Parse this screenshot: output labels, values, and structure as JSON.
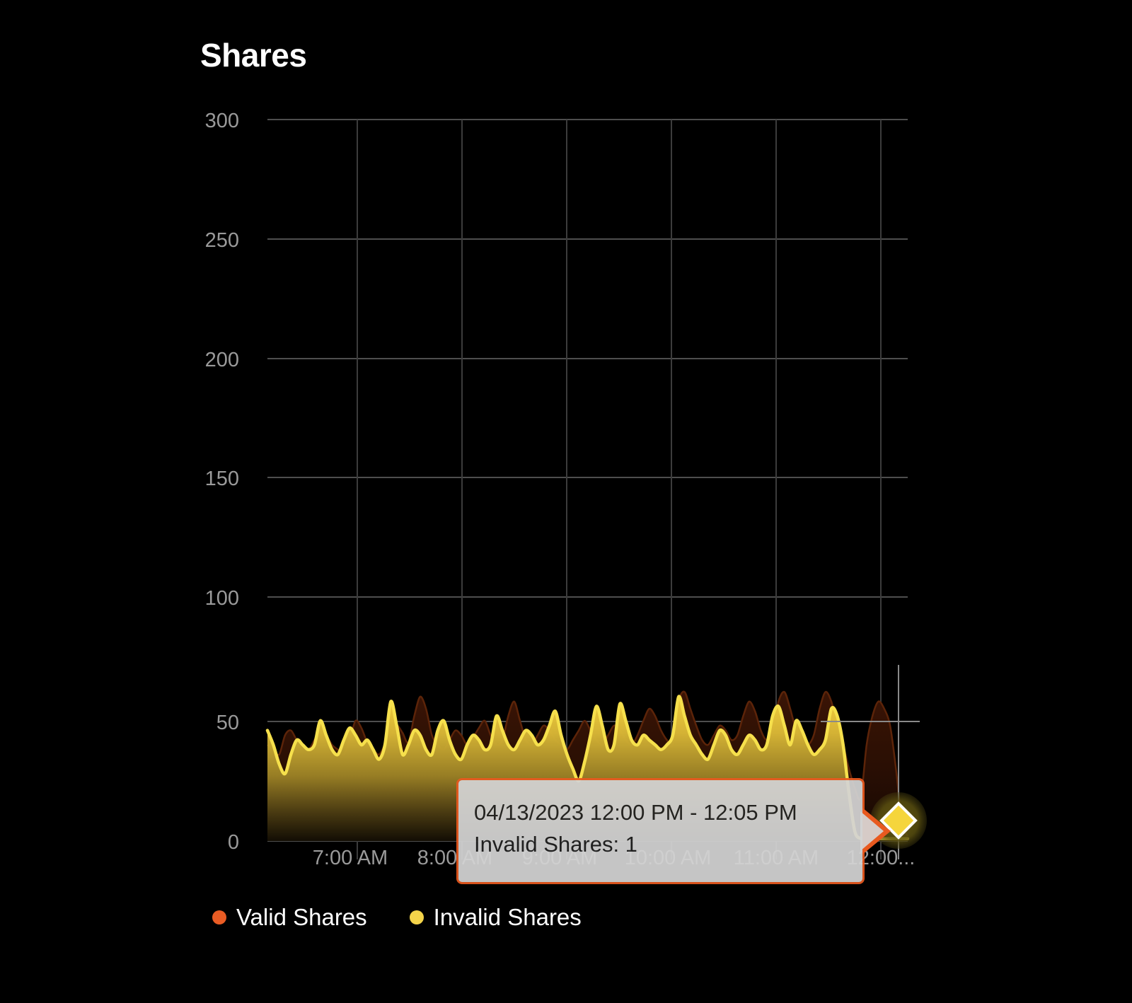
{
  "chart_title": "Shares",
  "legend": {
    "items": [
      {
        "label": "Valid Shares",
        "color": "#ea5c24"
      },
      {
        "label": "Invalid Shares",
        "color": "#f4d44a"
      }
    ]
  },
  "tooltip": {
    "time_range": "04/13/2023 12:00 PM - 12:05 PM",
    "value_line": "Invalid Shares: 1"
  },
  "axis": {
    "y_ticks": [
      "0",
      "50",
      "100",
      "150",
      "200",
      "250",
      "300"
    ],
    "x_ticks": [
      "7:00 AM",
      "8:00 AM",
      "9:00 AM",
      "10:00 AM",
      "11:00 AM",
      "12:00..."
    ]
  },
  "chart_data": {
    "type": "area",
    "title": "Shares",
    "xlabel": "",
    "ylabel": "",
    "ylim": [
      0,
      300
    ],
    "y_ticks": [
      0,
      50,
      100,
      150,
      200,
      250,
      300
    ],
    "x_tick_labels": [
      "7:00 AM",
      "8:00 AM",
      "9:00 AM",
      "10:00 AM",
      "11:00 AM",
      "12:00..."
    ],
    "x_range": "04/13/2023 06:40 AM - 12:20 PM",
    "grid": true,
    "legend_position": "bottom-left",
    "interval_minutes": 5,
    "highlighted_point": {
      "series": "Invalid Shares",
      "label": "04/13/2023 12:00 PM - 12:05 PM",
      "value": 1
    },
    "series": [
      {
        "name": "Valid Shares",
        "color": "#ea5c24",
        "fill_opacity": 0.28,
        "values": [
          40,
          38,
          36,
          44,
          46,
          42,
          40,
          38,
          42,
          46,
          44,
          40,
          38,
          36,
          42,
          50,
          47,
          41,
          38,
          36,
          40,
          44,
          48,
          45,
          41,
          52,
          60,
          55,
          44,
          40,
          38,
          42,
          46,
          44,
          40,
          43,
          47,
          50,
          44,
          40,
          42,
          52,
          58,
          50,
          42,
          40,
          44,
          48,
          46,
          42,
          40,
          38,
          42,
          46,
          50,
          46,
          42,
          40,
          44,
          48,
          46,
          42,
          40,
          44,
          50,
          55,
          52,
          46,
          42,
          40,
          58,
          62,
          55,
          48,
          42,
          40,
          44,
          48,
          46,
          42,
          44,
          52,
          58,
          54,
          46,
          42,
          46,
          58,
          62,
          55,
          46,
          42,
          40,
          44,
          55,
          62,
          58,
          48,
          40,
          30,
          22,
          18,
          40,
          52,
          58,
          55,
          48,
          30,
          8,
          2
        ]
      },
      {
        "name": "Invalid Shares",
        "color": "#f4d44a",
        "fill_opacity": 1.0,
        "values": [
          46,
          40,
          32,
          28,
          36,
          42,
          40,
          38,
          40,
          50,
          44,
          38,
          36,
          42,
          47,
          44,
          40,
          42,
          38,
          34,
          40,
          58,
          48,
          36,
          40,
          46,
          44,
          38,
          36,
          46,
          50,
          42,
          36,
          34,
          40,
          44,
          42,
          38,
          40,
          52,
          46,
          40,
          38,
          42,
          46,
          44,
          40,
          42,
          48,
          54,
          44,
          36,
          30,
          25,
          33,
          44,
          56,
          48,
          38,
          40,
          57,
          50,
          42,
          40,
          44,
          42,
          40,
          38,
          40,
          44,
          60,
          52,
          44,
          40,
          36,
          34,
          40,
          46,
          44,
          38,
          36,
          40,
          44,
          42,
          38,
          40,
          52,
          56,
          48,
          40,
          50,
          46,
          40,
          36,
          38,
          42,
          55,
          52,
          40,
          20,
          4,
          1,
          1,
          1,
          1,
          1,
          1,
          1,
          1,
          1
        ]
      }
    ]
  }
}
